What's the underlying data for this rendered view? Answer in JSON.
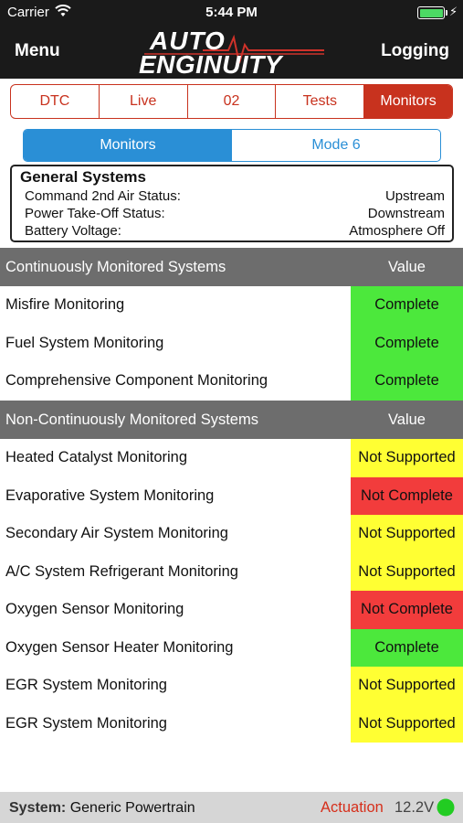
{
  "status_bar": {
    "carrier": "Carrier",
    "time": "5:44 PM",
    "wifi_icon": "wifi-icon",
    "battery_icon": "battery-icon",
    "battery_level": 1.0
  },
  "nav": {
    "menu_label": "Menu",
    "logging_label": "Logging",
    "logo_line1": "AUTO",
    "logo_line2": "ENGINUITY"
  },
  "tabs": [
    {
      "label": "DTC",
      "active": false
    },
    {
      "label": "Live",
      "active": false
    },
    {
      "label": "02",
      "active": false
    },
    {
      "label": "Tests",
      "active": false
    },
    {
      "label": "Monitors",
      "active": true
    }
  ],
  "segment": {
    "options": [
      {
        "label": "Monitors",
        "active": true
      },
      {
        "label": "Mode 6",
        "active": false
      }
    ]
  },
  "general_systems": {
    "title": "General Systems",
    "rows": [
      {
        "label": "Command 2nd Air Status:",
        "value": "Upstream"
      },
      {
        "label": "Power Take-Off Status:",
        "value": "Downstream"
      },
      {
        "label": "Battery Voltage:",
        "value": "Atmosphere Off"
      }
    ]
  },
  "continuous": {
    "header": "Continuously Monitored Systems",
    "value_header": "Value",
    "rows": [
      {
        "name": "Misfire Monitoring",
        "status": "Complete",
        "color": "green"
      },
      {
        "name": "Fuel System Monitoring",
        "status": "Complete",
        "color": "green"
      },
      {
        "name": "Comprehensive Component Monitoring",
        "status": "Complete",
        "color": "green"
      }
    ]
  },
  "non_continuous": {
    "header": "Non-Continuously Monitored Systems",
    "value_header": "Value",
    "rows": [
      {
        "name": "Heated Catalyst Monitoring",
        "status": "Not Supported",
        "color": "yellow"
      },
      {
        "name": "Evaporative System Monitoring",
        "status": "Not Complete",
        "color": "red"
      },
      {
        "name": "Secondary Air System Monitoring",
        "status": "Not Supported",
        "color": "yellow"
      },
      {
        "name": "A/C System Refrigerant Monitoring",
        "status": "Not Supported",
        "color": "yellow"
      },
      {
        "name": "Oxygen Sensor Monitoring",
        "status": "Not Complete",
        "color": "red"
      },
      {
        "name": "Oxygen Sensor Heater Monitoring",
        "status": "Complete",
        "color": "green"
      },
      {
        "name": "EGR System Monitoring",
        "status": "Not Supported",
        "color": "yellow"
      },
      {
        "name": "EGR System Monitoring",
        "status": "Not Supported",
        "color": "yellow"
      }
    ]
  },
  "footer": {
    "system_label": "System:",
    "system_value": "Generic Powertrain",
    "actuation_label": "Actuation",
    "voltage": "12.2V",
    "connection_color": "#22cc22"
  },
  "colors": {
    "accent_red": "#c8321e",
    "accent_blue": "#2a8fd6",
    "complete": "#4ce83c",
    "not_supported": "#ffff33",
    "not_complete": "#f23c3c"
  }
}
